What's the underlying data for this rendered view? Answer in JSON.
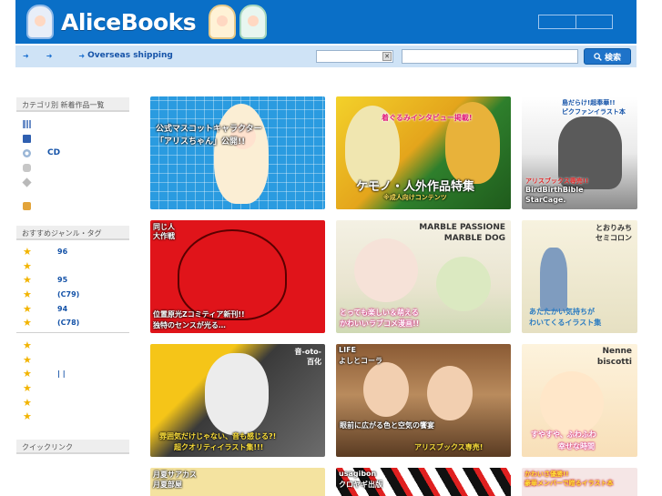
{
  "header": {
    "logo_text": "AliceBooks"
  },
  "navbar": {
    "links": [
      "",
      "",
      "Overseas shipping"
    ],
    "search_button": "検索",
    "category_select_value": "",
    "search_placeholder": ""
  },
  "sidebar": {
    "category_heading": "カテゴリ別 新着作品一覧",
    "categories": [
      {
        "icon": "grid-icon",
        "label": ""
      },
      {
        "icon": "book-icon",
        "label": ""
      },
      {
        "icon": "cd-icon",
        "label": "CD"
      },
      {
        "icon": "game-icon",
        "label": ""
      },
      {
        "icon": "goods-icon",
        "label": ""
      },
      {
        "icon": "user-icon",
        "label": ""
      }
    ],
    "genre_heading": "おすすめジャンル・タグ",
    "tags": [
      "96",
      "",
      "95",
      "(C79)",
      "94",
      "(C78)"
    ],
    "tags2": [
      "",
      "",
      "|  |",
      "",
      "",
      ""
    ],
    "quicklink_heading": "クイックリンク"
  },
  "banners": [
    {
      "caption1": "公式マスコットキャラクター",
      "caption2": "「アリスちゃん」公開!!"
    },
    {
      "caption1": "着ぐるみインタビュー掲載!",
      "caption2": "ケモノ・人外作品特集",
      "caption3": "※成人向けコンテンツ"
    },
    {
      "caption1": "島だらけ!超奉華!!",
      "caption2": "ピクファンイラスト本",
      "caption3": "アリスブックス専売!!",
      "caption4": "BirdBirthBible",
      "caption5": "StarCage."
    },
    {
      "caption1": "同じ人",
      "caption2": "大作戦",
      "caption3": "位置原光Zコミティア新刊!!",
      "caption4": "独特のセンスが光る…"
    },
    {
      "caption1": "MARBLE PASSIONE",
      "caption2": "MARBLE DOG",
      "caption3": "とっても楽しい＆萌える",
      "caption4": "かわいいラブコメ漫画!!"
    },
    {
      "caption1": "とおりみち",
      "caption2": "セミコロン",
      "caption3": "あたたかい気持ちが",
      "caption4": "わいてくるイラスト集"
    },
    {
      "caption1": "音-oto-",
      "caption2": "百化",
      "caption3": "雰囲気だけじゃない、音も感じる?!",
      "caption4": "超クオリティイラスト集!!!"
    },
    {
      "caption1": "LIFE",
      "caption2": "よしとコーラ",
      "caption3": "眼前に広がる色と空気の饗宴",
      "caption4": "アリスブックス専売!"
    },
    {
      "caption1": "Nenne",
      "caption2": "biscotti",
      "caption3": "すやすや、ふわふわ",
      "caption4": "幸せな時間"
    },
    {
      "caption1": "月夏サアカス",
      "caption2": "月夏部屋"
    },
    {
      "caption1": "usagibon",
      "caption2": "クロヤギ出版"
    },
    {
      "caption1": "かわいさ優勝!!",
      "caption2": "豪華メンバーで贈るイラスト本"
    }
  ]
}
